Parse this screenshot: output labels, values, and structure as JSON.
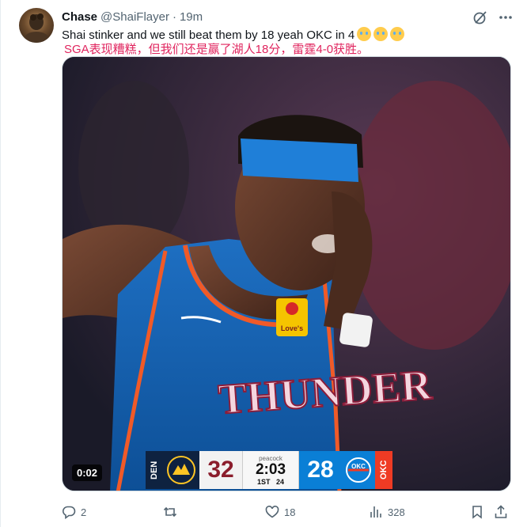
{
  "tweet": {
    "author_name": "Chase",
    "author_handle": "@ShaiFlayer",
    "separator": "·",
    "timestamp": "19m",
    "text": "Shai stinker and we still beat them by 18 yeah OKC in 4",
    "emojis": [
      "loudly-crying-face-emoji",
      "loudly-crying-face-emoji",
      "loudly-crying-face-emoji"
    ],
    "translation": "SGA表现糟糕，但我们还是赢了湖人18分，雷霆4-0获胜。"
  },
  "video": {
    "duration": "0:02",
    "jersey_text": "THUNDER",
    "scorebug": {
      "den_tag": "DEN",
      "den_score": "32",
      "network": "peacock",
      "clock": "2:03",
      "period": "1ST",
      "shot_clock": "24",
      "okc_score": "28",
      "okc_tag": "OKC"
    }
  },
  "actions": {
    "replies": "2",
    "retweets": "",
    "likes": "18",
    "views": "328"
  },
  "colors": {
    "text": "#0f1419",
    "secondary": "#536471",
    "translation": "#e0245e",
    "okc_blue": "#0a7fd6",
    "den_navy": "#0e2240"
  }
}
